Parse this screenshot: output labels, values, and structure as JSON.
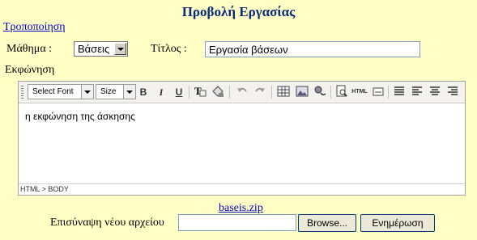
{
  "page": {
    "title": "Προβολή Εργασίας",
    "edit_link": "Τροποποίηση"
  },
  "form": {
    "subject_label": "Μάθημα :",
    "subject_value": "Βάσεις",
    "title_label": "Τίτλος :",
    "title_value": "Εργασία βάσεων",
    "description_label": "Εκφώνηση"
  },
  "editor": {
    "toolbar": {
      "font_select": "Select Font",
      "size_select": "Size",
      "bold": "B",
      "italic": "I",
      "underline": "U",
      "html_button": "HTML"
    },
    "content": "η εκφώνηση της άσκησης",
    "status_path": "HTML > BODY"
  },
  "attachment": {
    "current_file": "baseis.zip",
    "attach_label": "Επισύναψη νέου αρχείου",
    "browse_label": "Browse...",
    "update_label": "Ενημέρωση"
  }
}
